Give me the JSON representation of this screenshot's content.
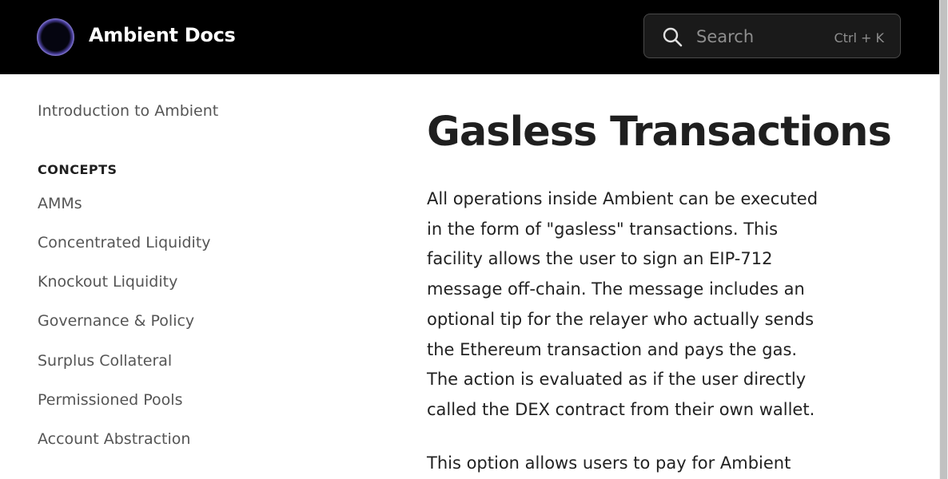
{
  "header": {
    "brand": "Ambient Docs",
    "search": {
      "placeholder": "Search",
      "shortcut": "Ctrl + K"
    }
  },
  "sidebar": {
    "intro": "Introduction to Ambient",
    "section_heading": "CONCEPTS",
    "items": [
      "AMMs",
      "Concentrated Liquidity",
      "Knockout Liquidity",
      "Governance & Policy",
      "Surplus Collateral",
      "Permissioned Pools",
      "Account Abstraction"
    ]
  },
  "main": {
    "title": "Gasless Transactions",
    "paragraph1_lines": [
      "All operations inside Ambient can be executed",
      "in the form of \"gasless\" transactions. This",
      "facility allows the user to sign an EIP-712",
      "message off-chain. The message includes an",
      "optional tip for the relayer who actually sends",
      "the Ethereum transaction and pays the gas.",
      "The action is evaluated as if the user directly",
      "called the DEX contract from their own wallet."
    ],
    "paragraph2_lines": [
      "This option allows users to pay for Ambient"
    ]
  },
  "colors": {
    "header_bg": "#000000",
    "page_bg": "#ffffff",
    "text": "#1f1f1f",
    "muted_text": "#555555",
    "logo_accent": "#a9a0f0"
  }
}
